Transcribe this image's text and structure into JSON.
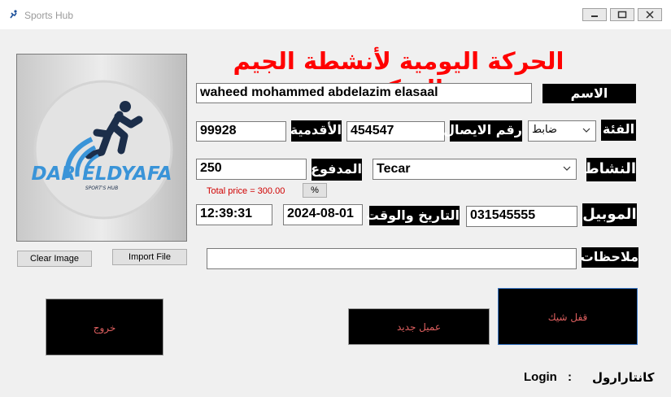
{
  "window": {
    "title": "Sports Hub",
    "minimize_icon": "minimize-icon",
    "maximize_icon": "maximize-icon",
    "close_icon": "close-icon"
  },
  "header": {
    "title": "الحركة اليومية لأنشطة الجيم الميكس"
  },
  "logo": {
    "brand": "DAR ELDYAFA",
    "tagline": "SPORT'S HUB"
  },
  "image_buttons": {
    "clear": "Clear Image",
    "import": "Import File"
  },
  "form": {
    "name": {
      "label": "الاسم",
      "value": "waheed mohammed abdelazim elasaal"
    },
    "category": {
      "label": "الفئة",
      "value": "ضابط"
    },
    "receipt": {
      "label": "رقم الايصال",
      "value": "454547"
    },
    "seniority": {
      "label": "الأقدمية",
      "value": "99928"
    },
    "activity": {
      "label": "النشاط",
      "value": "Tecar"
    },
    "paid": {
      "label": "المدفوع",
      "value": "250"
    },
    "total_price": "Total price = 300.00",
    "percent_button": "%",
    "mobile": {
      "label": "الموبيل",
      "value": "031545555"
    },
    "datetime": {
      "label": "التاريخ والوقت",
      "date": "2024-08-01",
      "time": "12:39:31"
    },
    "notes": {
      "label": "ملاحظات",
      "value": ""
    }
  },
  "actions": {
    "lock_check": "قفل شيك",
    "new_client": "عميل جديد",
    "exit": "خروج"
  },
  "login": {
    "label": "Login",
    "colon": ":",
    "user": "كانتارارول"
  },
  "colors": {
    "title_red": "#ff0000",
    "button_text": "#e06060",
    "label_bg": "#000000"
  }
}
